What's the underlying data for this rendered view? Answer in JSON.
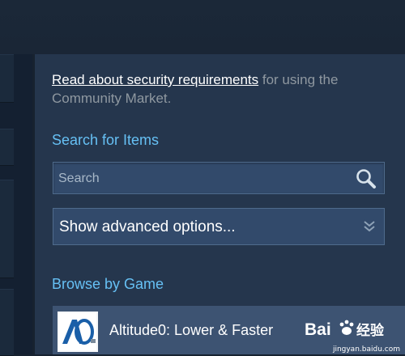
{
  "market": {
    "security_link": "Read about security requirements",
    "security_rest": " for using the Community Market."
  },
  "search": {
    "section_title": "Search for Items",
    "placeholder": "Search",
    "value": ""
  },
  "advanced": {
    "label": "Show advanced options..."
  },
  "browse": {
    "section_title": "Browse by Game",
    "games": [
      {
        "name": "Altitude0: Lower & Faster",
        "icon": "altitude0-logo-icon"
      }
    ]
  },
  "watermark": {
    "brand": "Bai经验",
    "url": "jingyan.baidu.com"
  },
  "colors": {
    "background": "#172230",
    "panel": "#25364d",
    "accent": "#66c0f4",
    "input_bg": "#324a6b"
  }
}
